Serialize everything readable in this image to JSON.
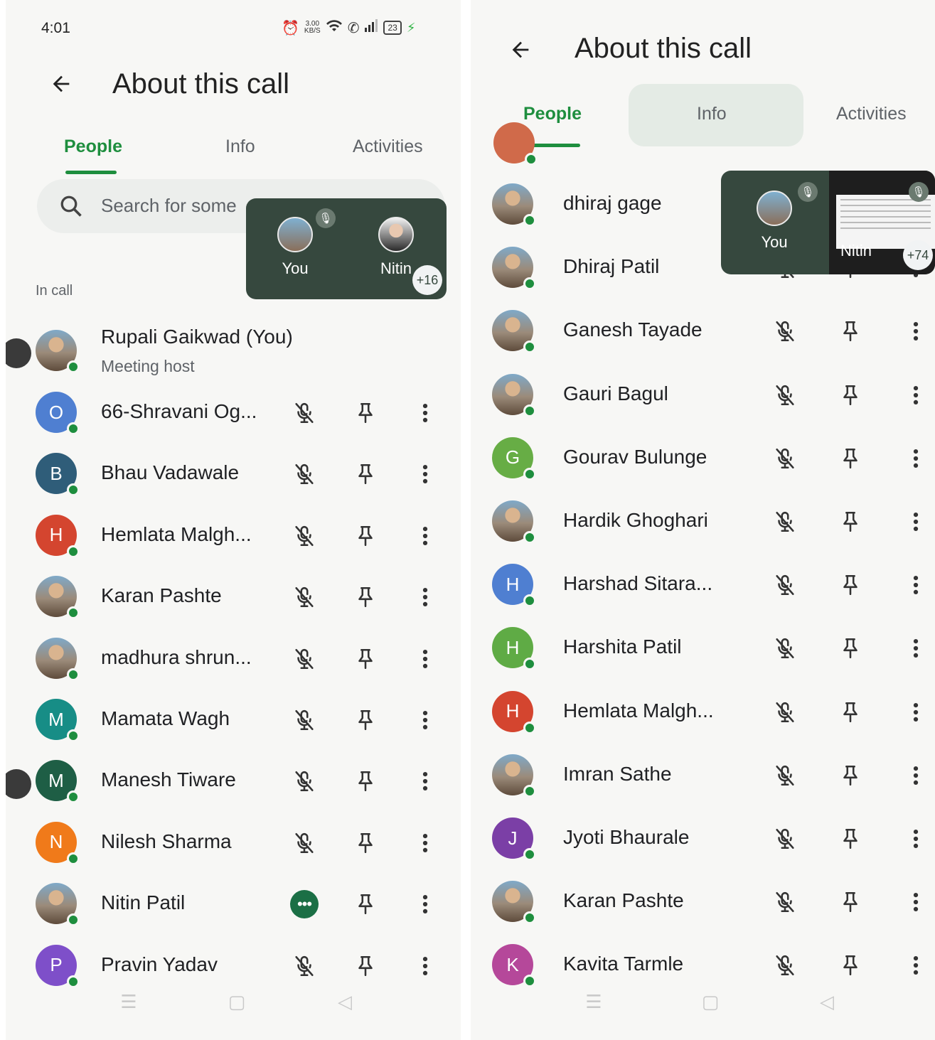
{
  "left": {
    "status": {
      "time": "4:01",
      "speed": "3.00",
      "speed_unit": "KB/S",
      "battery": "23"
    },
    "title": "About this call",
    "tabs": [
      "People",
      "Info",
      "Activities"
    ],
    "search_placeholder": "Search for some",
    "pip": {
      "you_label": "You",
      "other_label": "Nitin",
      "extra_count": "+16"
    },
    "section_label": "In call",
    "host": {
      "initial": "",
      "name": "Rupali Gaikwad (You)",
      "role": "Meeting host"
    },
    "participants": [
      {
        "initial": "O",
        "name": "66-Shravani Og...",
        "color": "#4f7fd1",
        "photo": false,
        "state": "muted"
      },
      {
        "initial": "B",
        "name": "Bhau Vadawale",
        "color": "#2f5d79",
        "photo": false,
        "state": "muted"
      },
      {
        "initial": "H",
        "name": "Hemlata Malgh...",
        "color": "#d4452f",
        "photo": false,
        "state": "muted"
      },
      {
        "initial": "",
        "name": "Karan Pashte",
        "color": "#d4a57a",
        "photo": true,
        "state": "muted"
      },
      {
        "initial": "",
        "name": "madhura shrun...",
        "color": "#6a4b4b",
        "photo": true,
        "state": "muted"
      },
      {
        "initial": "M",
        "name": "Mamata Wagh",
        "color": "#178d86",
        "photo": false,
        "state": "muted"
      },
      {
        "initial": "M",
        "name": "Manesh Tiware",
        "color": "#1e5e45",
        "photo": false,
        "state": "muted"
      },
      {
        "initial": "N",
        "name": "Nilesh Sharma",
        "color": "#f07a1a",
        "photo": false,
        "state": "muted"
      },
      {
        "initial": "",
        "name": "Nitin Patil",
        "color": "#9aa0a6",
        "photo": true,
        "state": "speaking"
      },
      {
        "initial": "P",
        "name": "Pravin Yadav",
        "color": "#7e4fc9",
        "photo": false,
        "state": "muted"
      }
    ]
  },
  "right": {
    "title": "About this call",
    "tabs": [
      "People",
      "Info",
      "Activities"
    ],
    "pip": {
      "you_label": "You",
      "other_label": "Nitin",
      "extra_count": "+74"
    },
    "participants": [
      {
        "initial": "",
        "name": "dhiraj gage",
        "color": "#8fb3c9",
        "photo": true
      },
      {
        "initial": "",
        "name": "Dhiraj Patil",
        "color": "#5a7a3a",
        "photo": true
      },
      {
        "initial": "",
        "name": "Ganesh Tayade",
        "color": "#b38b6d",
        "photo": true
      },
      {
        "initial": "",
        "name": "Gauri Bagul",
        "color": "#c0502f",
        "photo": true
      },
      {
        "initial": "G",
        "name": "Gourav Bulunge",
        "color": "#67ad45",
        "photo": false
      },
      {
        "initial": "",
        "name": "Hardik Ghoghari",
        "color": "#1f3f7a",
        "photo": true
      },
      {
        "initial": "H",
        "name": "Harshad Sitara...",
        "color": "#4f7fd1",
        "photo": false
      },
      {
        "initial": "H",
        "name": "Harshita Patil",
        "color": "#5fab45",
        "photo": false
      },
      {
        "initial": "H",
        "name": "Hemlata Malgh...",
        "color": "#d4452f",
        "photo": false
      },
      {
        "initial": "",
        "name": "Imran Sathe",
        "color": "#2e3f5a",
        "photo": true
      },
      {
        "initial": "J",
        "name": "Jyoti Bhaurale",
        "color": "#7b3fa6",
        "photo": false
      },
      {
        "initial": "",
        "name": "Karan Pashte",
        "color": "#d4a57a",
        "photo": true
      },
      {
        "initial": "K",
        "name": "Kavita Tarmle",
        "color": "#b5489a",
        "photo": false
      }
    ]
  },
  "icons": {
    "back": "arrow-back-icon",
    "search": "search-icon",
    "muted": "mic-off-icon",
    "pin": "pin-icon",
    "more": "more-vert-icon",
    "speaking": "speaking-dots-icon"
  },
  "colors": {
    "accent": "#1e8e3e",
    "pip_bg": "#36483e"
  }
}
